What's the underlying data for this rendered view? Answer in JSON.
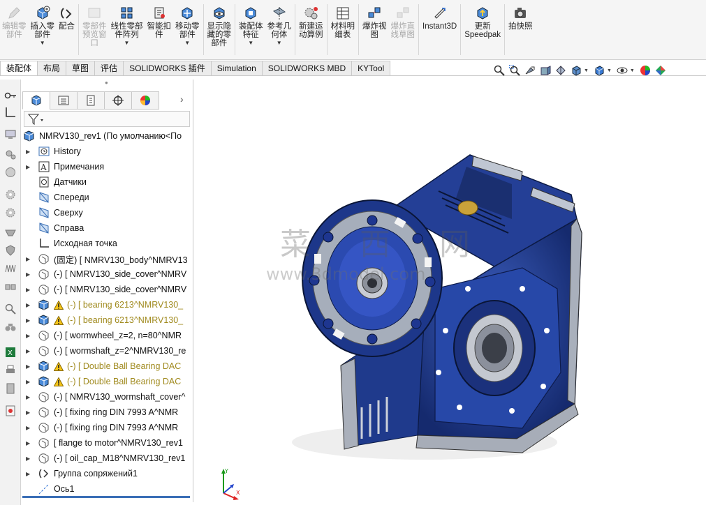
{
  "ribbon": {
    "buttons": [
      {
        "label": "编辑零\n部件",
        "icon": "edit-component-icon",
        "disabled": true
      },
      {
        "label": "插入零\n部件",
        "icon": "insert-component-icon",
        "dropdown": true
      },
      {
        "label": "配合",
        "icon": "mate-icon"
      },
      {
        "label": "零部件\n预览窗\n口",
        "icon": "component-preview-icon",
        "disabled": true
      },
      {
        "label": "线性零部\n件阵列",
        "icon": "linear-pattern-icon",
        "dropdown": true
      },
      {
        "label": "智能扣\n件",
        "icon": "smart-fasteners-icon"
      },
      {
        "label": "移动零\n部件",
        "icon": "move-component-icon",
        "dropdown": true
      },
      {
        "label": "显示隐\n藏的零\n部件",
        "icon": "show-hidden-icon"
      },
      {
        "label": "装配体\n特征",
        "icon": "assembly-features-icon",
        "dropdown": true
      },
      {
        "label": "参考几\n何体",
        "icon": "reference-geometry-icon",
        "dropdown": true
      },
      {
        "label": "新建运\n动算例",
        "icon": "new-motion-study-icon"
      },
      {
        "label": "材料明\n细表",
        "icon": "bill-of-materials-icon"
      },
      {
        "label": "爆炸视\n图",
        "icon": "exploded-view-icon"
      },
      {
        "label": "爆炸直\n线草图",
        "icon": "explode-line-sketch-icon",
        "disabled": true
      },
      {
        "label": "Instant3D",
        "icon": "instant3d-icon"
      },
      {
        "label": "更新\nSpeedpak",
        "icon": "update-speedpak-icon"
      },
      {
        "label": "拍快照",
        "icon": "snapshot-icon"
      }
    ]
  },
  "tabs": [
    "装配体",
    "布局",
    "草图",
    "评估",
    "SOLIDWORKS 插件",
    "Simulation",
    "SOLIDWORKS MBD",
    "KYTool"
  ],
  "active_tab": "装配体",
  "tree": {
    "root": "NMRV130_rev1  (По умолчанию<По",
    "items": [
      {
        "text": "History",
        "icon": "history-icon",
        "expand": true
      },
      {
        "text": "Примечания",
        "icon": "annotations-icon",
        "expand": true
      },
      {
        "text": "Датчики",
        "icon": "sensors-icon",
        "expand": false
      },
      {
        "text": "Спереди",
        "icon": "plane-icon",
        "expand": false
      },
      {
        "text": "Сверху",
        "icon": "plane-icon",
        "expand": false
      },
      {
        "text": "Справа",
        "icon": "plane-icon",
        "expand": false
      },
      {
        "text": "Исходная точка",
        "icon": "origin-icon",
        "expand": false
      },
      {
        "text": "(固定) [ NMRV130_body^NMRV13",
        "icon": "part-icon",
        "expand": true
      },
      {
        "text": "(-) [ NMRV130_side_cover^NMRV",
        "icon": "part-icon",
        "expand": true
      },
      {
        "text": "(-) [ NMRV130_side_cover^NMRV",
        "icon": "part-icon",
        "expand": true
      },
      {
        "text": "(-) [ bearing 6213^NMRV130_",
        "icon": "assembly-icon",
        "expand": true,
        "warn": true
      },
      {
        "text": "(-) [ bearing 6213^NMRV130_",
        "icon": "assembly-icon",
        "expand": true,
        "warn": true
      },
      {
        "text": "(-) [ wormwheel_z=2, n=80^NMR",
        "icon": "part-icon",
        "expand": true
      },
      {
        "text": "(-) [ wormshaft_z=2^NMRV130_re",
        "icon": "part-icon",
        "expand": true
      },
      {
        "text": "(-) [ Double Ball Bearing DAC",
        "icon": "assembly-icon",
        "expand": true,
        "warn": true
      },
      {
        "text": "(-) [ Double Ball Bearing DAC",
        "icon": "assembly-icon",
        "expand": true,
        "warn": true
      },
      {
        "text": "(-) [ NMRV130_wormshaft_cover^",
        "icon": "part-icon",
        "expand": true
      },
      {
        "text": "(-) [ fixing ring DIN 7993 A^NMR",
        "icon": "part-icon",
        "expand": true
      },
      {
        "text": "(-) [ fixing ring DIN 7993 A^NMR",
        "icon": "part-icon",
        "expand": true
      },
      {
        "text": "[ flange to motor^NMRV130_rev1",
        "icon": "part-icon",
        "expand": true
      },
      {
        "text": "(-) [ oil_cap_M18^NMRV130_rev1",
        "icon": "part-icon",
        "expand": true
      },
      {
        "text": "Группа сопряжений1",
        "icon": "mates-icon",
        "expand": true
      },
      {
        "text": "Ось1",
        "icon": "axis-icon",
        "expand": false
      }
    ]
  },
  "viewport": {
    "watermark_cn": "菜 西 网",
    "watermark_url": "www.3dmodel.com",
    "model_color": "#1f3a8c"
  }
}
